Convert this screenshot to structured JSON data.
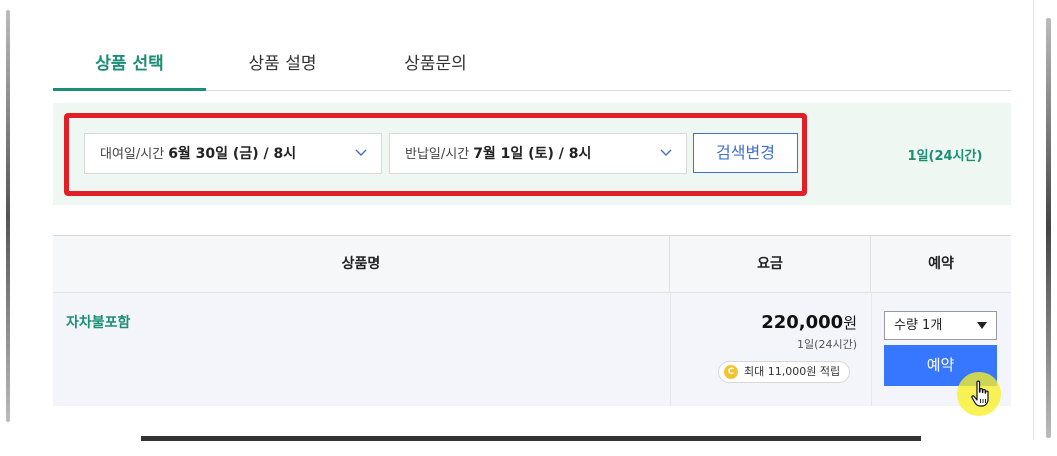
{
  "tabs": [
    {
      "label": "상품 선택",
      "active": true
    },
    {
      "label": "상품 설명",
      "active": false
    },
    {
      "label": "상품문의",
      "active": false
    }
  ],
  "search": {
    "start_label": "대여일/시간",
    "start_value": "6월 30일 (금) / 8시",
    "end_label": "반납일/시간",
    "end_value": "7월 1일 (토) / 8시",
    "button_label": "검색변경",
    "duration": "1일(24시간)"
  },
  "table": {
    "headers": {
      "name": "상품명",
      "price": "요금",
      "book": "예약"
    },
    "rows": [
      {
        "name": "자차불포함",
        "price": "220,000",
        "currency": "원",
        "price_sub": "1일(24시간)",
        "points_icon": "C",
        "points": "최대 11,000원 적립",
        "quantity": "수량 1개",
        "book_label": "예약"
      }
    ]
  },
  "colors": {
    "accent_green": "#1b8f75",
    "primary_blue": "#3777ff",
    "highlight_red": "#e21f26",
    "search_bg": "#eef7f1"
  },
  "icons": {
    "select_chevron": "chevron-down-icon",
    "quantity_dropdown": "triangle-down-icon",
    "points_coin": "coin-icon",
    "cursor": "hand-pointer-icon"
  }
}
